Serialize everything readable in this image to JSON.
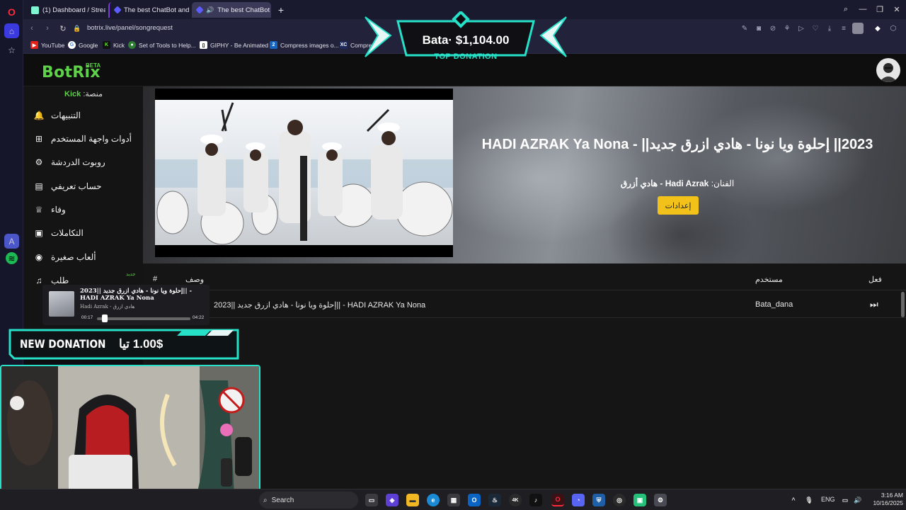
{
  "browser": {
    "tabs": [
      {
        "label": "(1) Dashboard / Streamlab",
        "active": false
      },
      {
        "label": "The best ChatBot and Wi",
        "active": false
      },
      {
        "label": "The best ChatBot and",
        "active": true
      }
    ],
    "new_tab_icon": "plus-icon",
    "url": "botrix.live/panel/songrequest",
    "bookmarks": [
      "YouTube",
      "Google",
      "Kick",
      "Set of Tools to Help...",
      "GIPHY - Be Animated",
      "Compress images o...",
      "Compres"
    ]
  },
  "overlays": {
    "top_donation": {
      "amount": "Bata· $1,104.00",
      "label": "TOP DONATION"
    },
    "new_donation": {
      "label": "NEW DONATION",
      "amount": "1.00$ تيا"
    },
    "now_playing": {
      "title": "2023|| إحلوة ويا نونا - هادي ازرق جديد|| - HADI AZRAK Ya Nona",
      "artist": "Hadi Azrak - هادي ازرق",
      "elapsed": "00:17",
      "duration": "04:22",
      "progress": 0.065
    }
  },
  "app": {
    "logo": "BotRix",
    "logo_badge": "BETA",
    "platform_label": "منصة:",
    "platform_value": "Kick",
    "sidebar": [
      {
        "label": "التنبيهات",
        "icon": "bell-icon"
      },
      {
        "label": "أدوات واجهة المستخدم",
        "icon": "windows-icon"
      },
      {
        "label": "روبوت الدردشة",
        "icon": "robot-icon"
      },
      {
        "label": "حساب تعريفي",
        "icon": "id-card-icon"
      },
      {
        "label": "وفاء",
        "icon": "trophy-icon"
      },
      {
        "label": "التكاملات",
        "icon": "cube-icon"
      },
      {
        "label": "ألعاب صغيرة",
        "icon": "gamepad-icon"
      }
    ],
    "sidebar_partial": {
      "label": "طلب",
      "badge": "جديد",
      "icon": "music-icon"
    },
    "song": {
      "title": "2023|| إحلوة ويا نونا - هادي ازرق جديد|| - HADI AZRAK Ya Nona",
      "artist_label": "الفنان:",
      "artist_value": "Hadi Azrak - هادي أزرق",
      "settings_button": "إعدادات"
    },
    "queue": {
      "columns": {
        "num": "#",
        "song": "وصف",
        "user": "مستخدم",
        "action": "فعل"
      },
      "rows": [
        {
          "song": "2023|| إحلوة ويا نونا - هادي ازرق جديد|| - HADI AZRAK Ya Nona",
          "user": "Bata_dana"
        }
      ]
    }
  },
  "taskbar": {
    "search_placeholder": "Search",
    "language": "ENG",
    "time": "3:16 AM",
    "date": "10/16/2025"
  },
  "colors": {
    "accent_green": "#5fd04a",
    "settings_yellow": "#f2c21b",
    "overlay_teal": "#26e0c8"
  }
}
